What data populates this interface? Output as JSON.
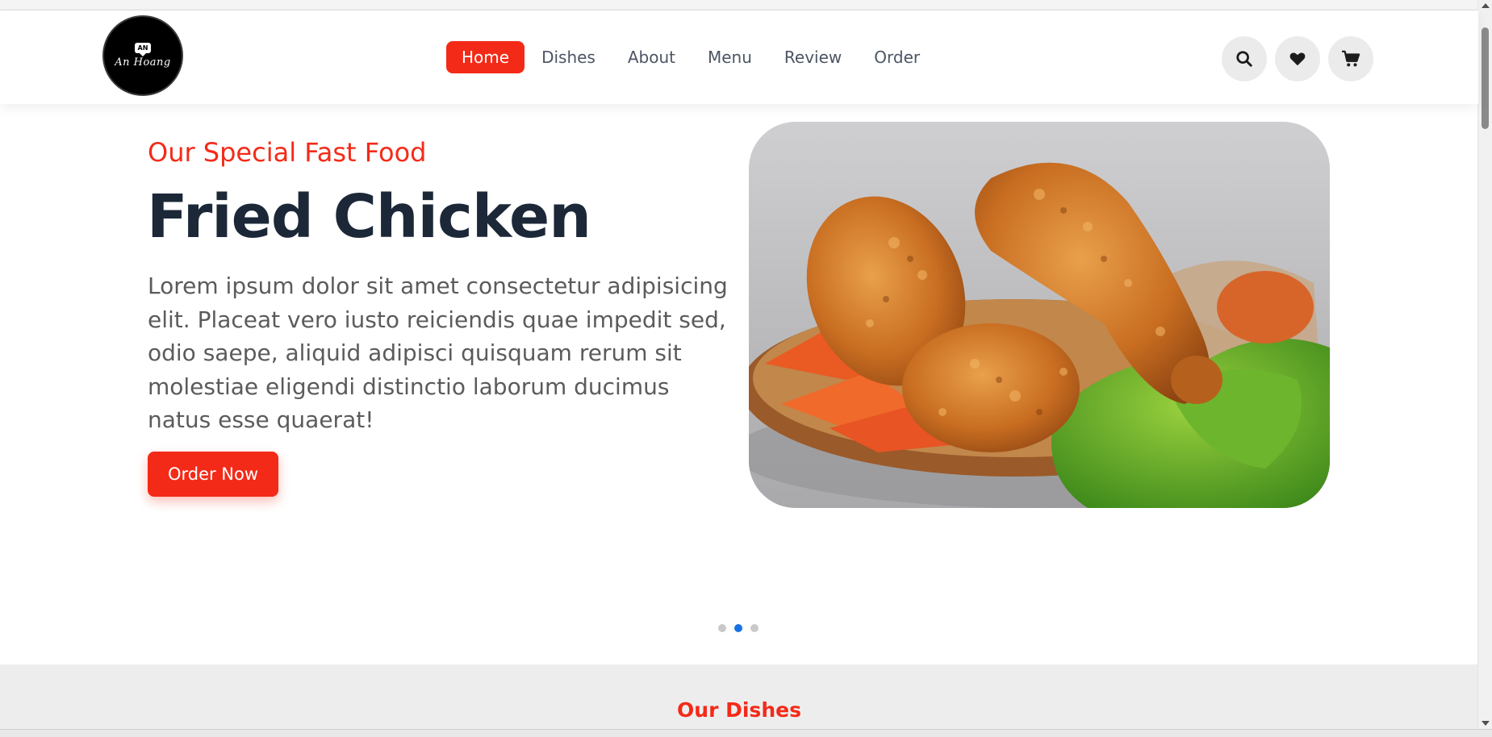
{
  "brand": {
    "logo_badge": "AN",
    "logo_text": "An Hoang"
  },
  "nav": {
    "items": [
      {
        "label": "Home",
        "active": true
      },
      {
        "label": "Dishes",
        "active": false
      },
      {
        "label": "About",
        "active": false
      },
      {
        "label": "Menu",
        "active": false
      },
      {
        "label": "Review",
        "active": false
      },
      {
        "label": "Order",
        "active": false
      }
    ]
  },
  "header_icons": [
    "search-icon",
    "heart-icon",
    "cart-icon"
  ],
  "hero": {
    "subtitle": "Our Special Fast Food",
    "title": "Fried Chicken",
    "description": "Lorem ipsum dolor sit amet consectetur adipisicing elit. Placeat vero iusto reiciendis quae impedit sed, odio saepe, aliquid adipisci quisquam rerum sit molestiae eligendi distinctio laborum ducimus natus esse quaerat!",
    "button_label": "Order Now"
  },
  "slider": {
    "total": 3,
    "active_index": 1
  },
  "dishes": {
    "title": "Our Dishes"
  },
  "colors": {
    "accent": "#f42a18",
    "heading": "#1c2838",
    "active_dot": "#1672e6"
  }
}
